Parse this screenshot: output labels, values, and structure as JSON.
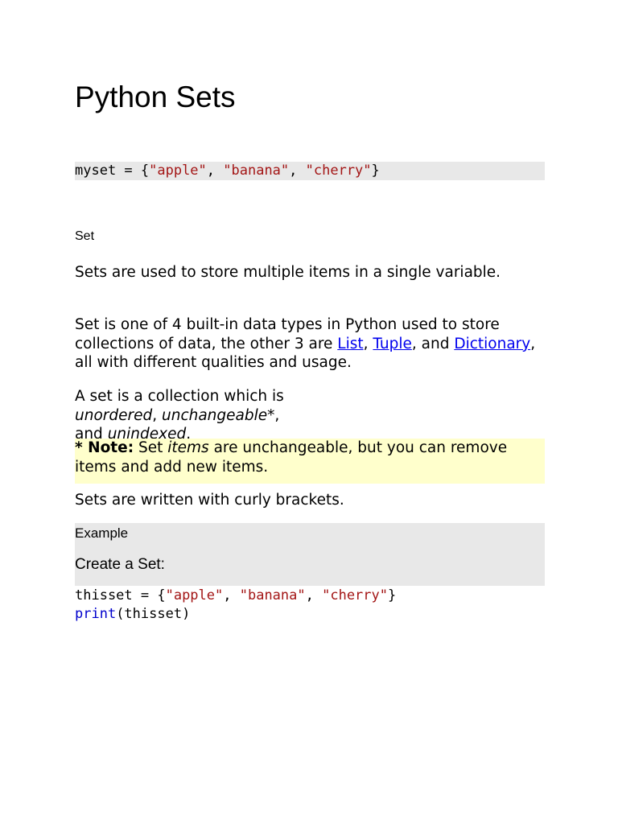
{
  "title": "Python Sets",
  "code1": {
    "prefix": "myset = {",
    "s1": "\"apple\"",
    "sep1": ", ",
    "s2": "\"banana\"",
    "sep2": ", ",
    "s3": "\"cherry\"",
    "suffix": "}"
  },
  "section_label": "Set",
  "p1": "Sets are used to store multiple items in a single variable.",
  "p2": {
    "text1": "Set is one of 4 built-in data types in Python used to store collections of data, the other 3 are ",
    "link_list": "List",
    "c1": ", ",
    "link_tuple": "Tuple",
    "c2": ", and ",
    "link_dict": "Dictionary",
    "text2": ", all with different qualities and usage."
  },
  "p3": {
    "text1": "A set is a collection which is ",
    "i1": "unordered",
    "c1": ", ",
    "i2": "unchangeable",
    "c2": "*, and ",
    "i3": "unindexed",
    "end": "."
  },
  "note": {
    "bold": "* Note:",
    "t1": " Set ",
    "i": "items",
    "t2": " are unchangeable, but you can remove items and add new items."
  },
  "p4": "Sets are written with curly brackets.",
  "example": {
    "label": "Example",
    "heading": "Create a Set:"
  },
  "code2": {
    "prefix": "thisset = {",
    "s1": "\"apple\"",
    "sep1": ", ",
    "s2": "\"banana\"",
    "sep2": ", ",
    "s3": "\"cherry\"",
    "suffix": "}",
    "kw": "print",
    "call": "(thisset)"
  },
  "colors": {
    "string": "#a31515",
    "keyword": "#0000cd",
    "link": "#0000ee",
    "note_bg": "#ffffcc",
    "code_bg": "#e8e8e8"
  }
}
